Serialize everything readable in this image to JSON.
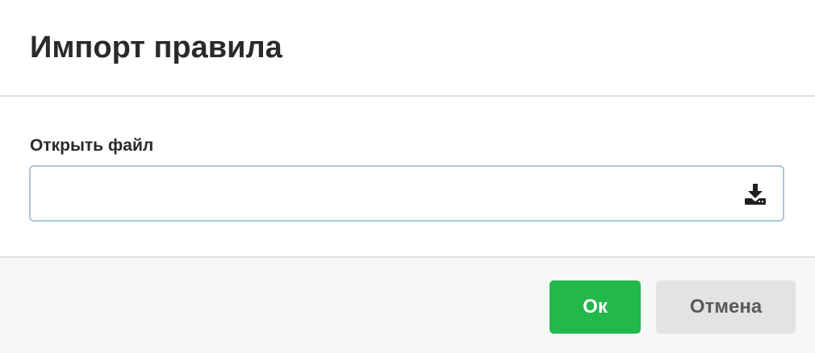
{
  "dialog": {
    "title": "Импорт правила"
  },
  "form": {
    "file_label": "Открыть файл",
    "file_value": "",
    "upload_icon": "download-tray-icon"
  },
  "footer": {
    "ok_label": "Ок",
    "cancel_label": "Отмена"
  },
  "colors": {
    "primary": "#22b84a",
    "secondary": "#e2e3e4",
    "input_border": "#a9c8db",
    "text": "#2a2a2a"
  }
}
